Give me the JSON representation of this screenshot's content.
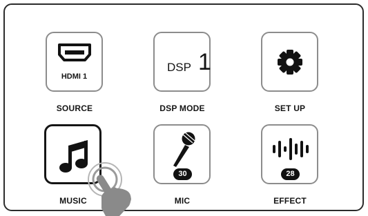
{
  "tiles": {
    "source": {
      "label": "SOURCE",
      "caption": "HDMI 1",
      "icon": "hdmi-icon"
    },
    "dsp_mode": {
      "label": "DSP MODE",
      "caption": "DSP",
      "value": "1",
      "icon": "dsp-icon"
    },
    "setup": {
      "label": "SET UP",
      "icon": "gear-icon"
    },
    "music": {
      "label": "MUSIC",
      "icon": "music-note-icon",
      "selected": true
    },
    "mic": {
      "label": "MIC",
      "badge": "30",
      "icon": "microphone-icon"
    },
    "effect": {
      "label": "EFFECT",
      "badge": "28",
      "icon": "waveform-icon"
    }
  },
  "colors": {
    "border": "#8c8c8c",
    "selected_border": "#151515",
    "icon": "#121212",
    "hand": "#8a8a8a"
  }
}
